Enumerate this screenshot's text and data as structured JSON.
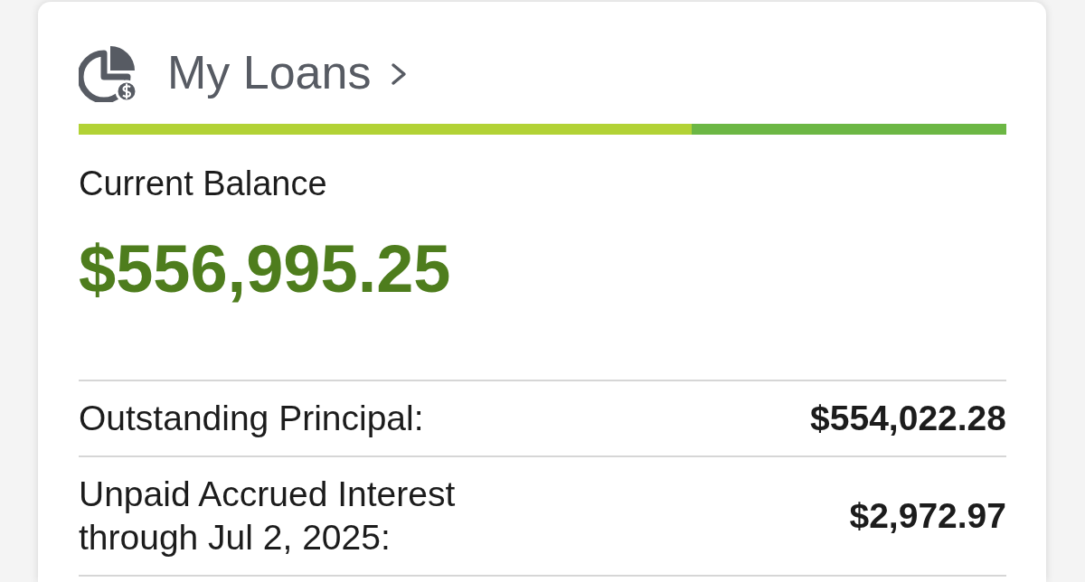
{
  "card": {
    "title": "My Loans",
    "balance": {
      "label": "Current Balance",
      "amount": "$556,995.25"
    },
    "details": [
      {
        "label": "Outstanding Principal:",
        "value": "$554,022.28"
      },
      {
        "label": "Unpaid Accrued Interest through Jul 2, 2025:",
        "value": "$2,972.97"
      }
    ]
  }
}
